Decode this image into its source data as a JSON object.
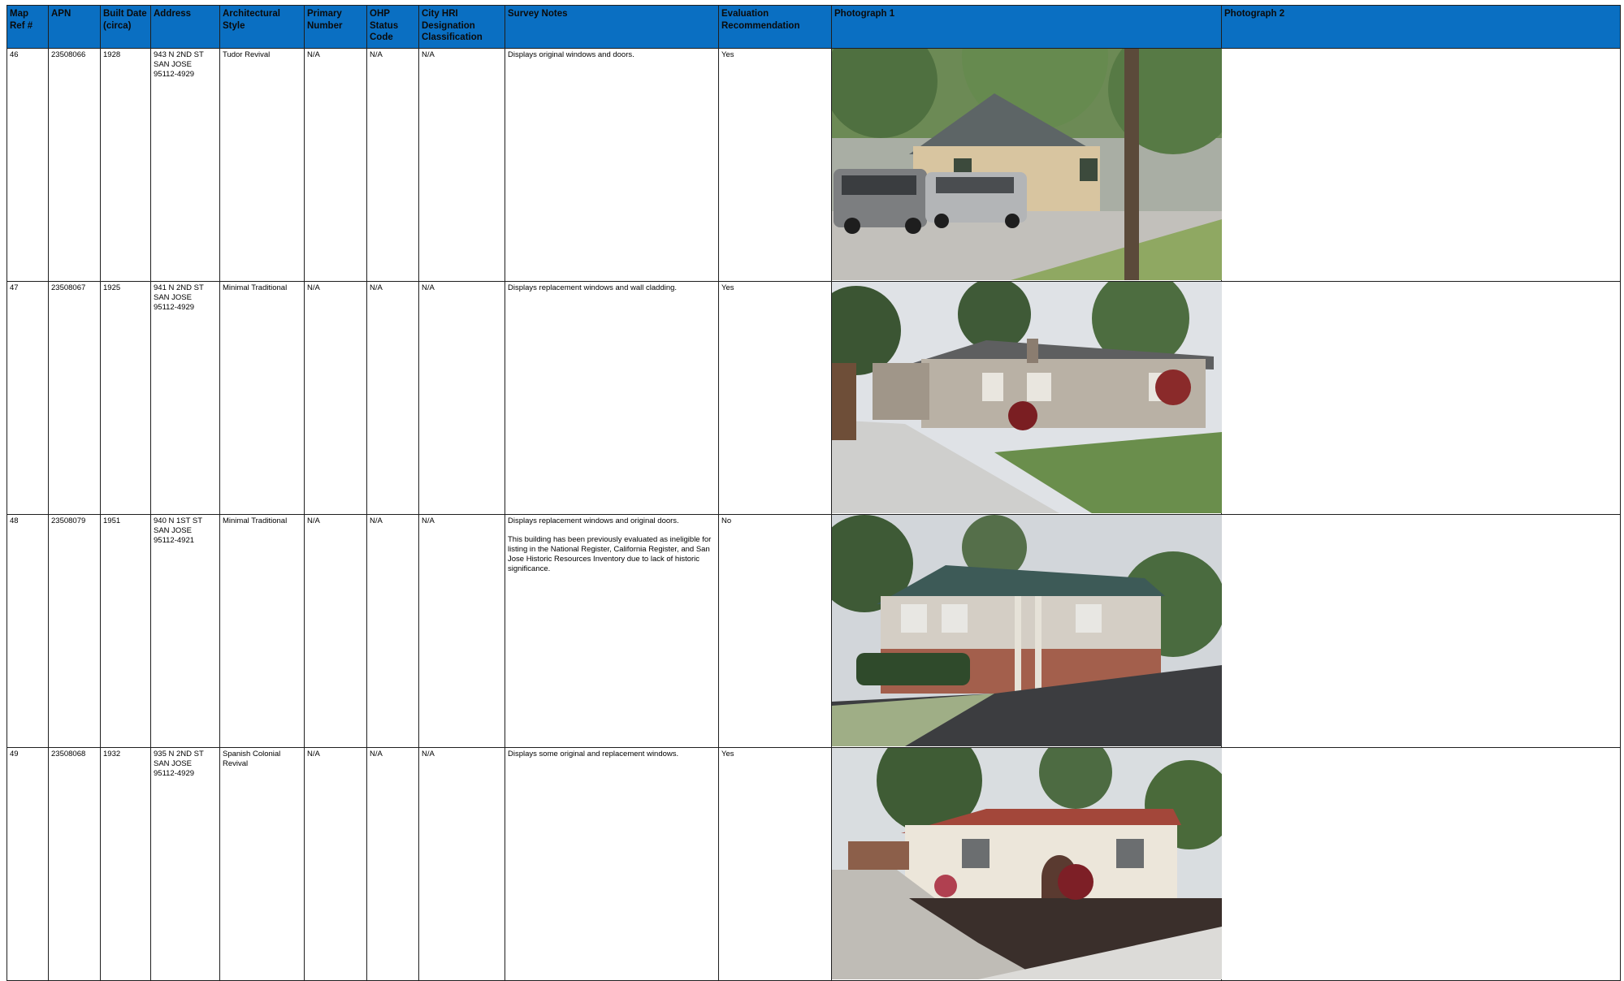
{
  "columns": {
    "map_ref": "Map Ref #",
    "apn": "APN",
    "built_date": "Built Date (circa)",
    "address": "Address",
    "arch_style": "Architectural Style",
    "primary_number": "Primary Number",
    "ohp_status": "OHP Status Code",
    "city_hri": "City HRI Designation Classification",
    "survey_notes": "Survey Notes",
    "evaluation": "Evaluation Recommendation",
    "photo1": "Photograph 1",
    "photo2": "Photograph 2"
  },
  "rows": [
    {
      "map_ref": "46",
      "apn": "23508066",
      "built": "1928",
      "address_line1": "943 N 2ND ST",
      "address_line2": "SAN JOSE",
      "address_line3": "95112-4929",
      "style": "Tudor Revival",
      "primary": "N/A",
      "ohp": "N/A",
      "hri": "N/A",
      "note1": "Displays original windows and doors.",
      "note2": "",
      "evaluation": "Yes"
    },
    {
      "map_ref": "47",
      "apn": "23508067",
      "built": "1925",
      "address_line1": "941 N 2ND ST",
      "address_line2": "SAN JOSE",
      "address_line3": "95112-4929",
      "style": "Minimal Traditional",
      "primary": "N/A",
      "ohp": "N/A",
      "hri": "N/A",
      "note1": "Displays replacement windows and wall cladding.",
      "note2": "",
      "evaluation": "Yes"
    },
    {
      "map_ref": "48",
      "apn": "23508079",
      "built": "1951",
      "address_line1": "940 N 1ST ST",
      "address_line2": "SAN JOSE",
      "address_line3": "95112-4921",
      "style": "Minimal Traditional",
      "primary": "N/A",
      "ohp": "N/A",
      "hri": "N/A",
      "note1": "Displays replacement windows and original doors.",
      "note2": "This building has been previously evaluated as ineligible for listing in the National Register, California Register, and San Jose Historic Resources Inventory due to lack of historic significance.",
      "evaluation": "No"
    },
    {
      "map_ref": "49",
      "apn": "23508068",
      "built": "1932",
      "address_line1": "935 N 2ND ST",
      "address_line2": "SAN JOSE",
      "address_line3": "95112-4929",
      "style": "Spanish Colonial Revival",
      "primary": "N/A",
      "ohp": "N/A",
      "hri": "N/A",
      "note1": "Displays some original and replacement windows.",
      "note2": "",
      "evaluation": "Yes"
    }
  ],
  "colors": {
    "header_bg": "#0a6fc2",
    "grid_line": "#1f1f1f"
  }
}
